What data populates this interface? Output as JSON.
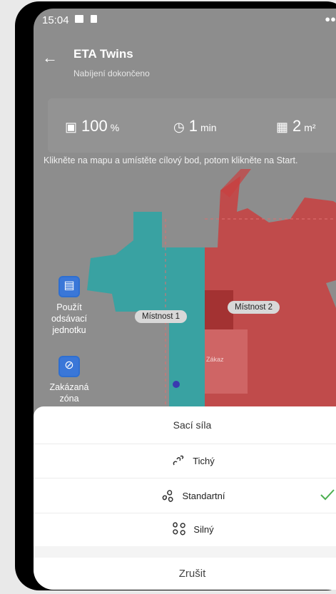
{
  "status_bar": {
    "time": "15:04"
  },
  "header": {
    "title": "ETA Twins",
    "subtitle": "Nabíjení dokončeno"
  },
  "stats": {
    "battery_value": "100",
    "battery_unit": "%",
    "time_value": "1",
    "time_unit": "min",
    "area_value": "2",
    "area_unit": "m²"
  },
  "instruction": "Klikněte na mapu a umístěte cílový bod, potom klikněte na Start.",
  "map": {
    "tools": [
      {
        "label": "Použít odsávací jednotku"
      },
      {
        "label": "Zakázaná zóna"
      }
    ],
    "rooms": [
      "Místnost 1",
      "Místnost 2"
    ],
    "zone_label": "Zákaz"
  },
  "sheet": {
    "title": "Sací síla",
    "options": [
      {
        "label": "Tichý",
        "selected": false
      },
      {
        "label": "Standartní",
        "selected": true
      },
      {
        "label": "Silný",
        "selected": false
      }
    ],
    "cancel": "Zrušit"
  },
  "colors": {
    "accent_check": "#4caf50",
    "room1": "#2aa6a6",
    "room2": "#c94040",
    "tool_blue": "#3a77d8"
  }
}
